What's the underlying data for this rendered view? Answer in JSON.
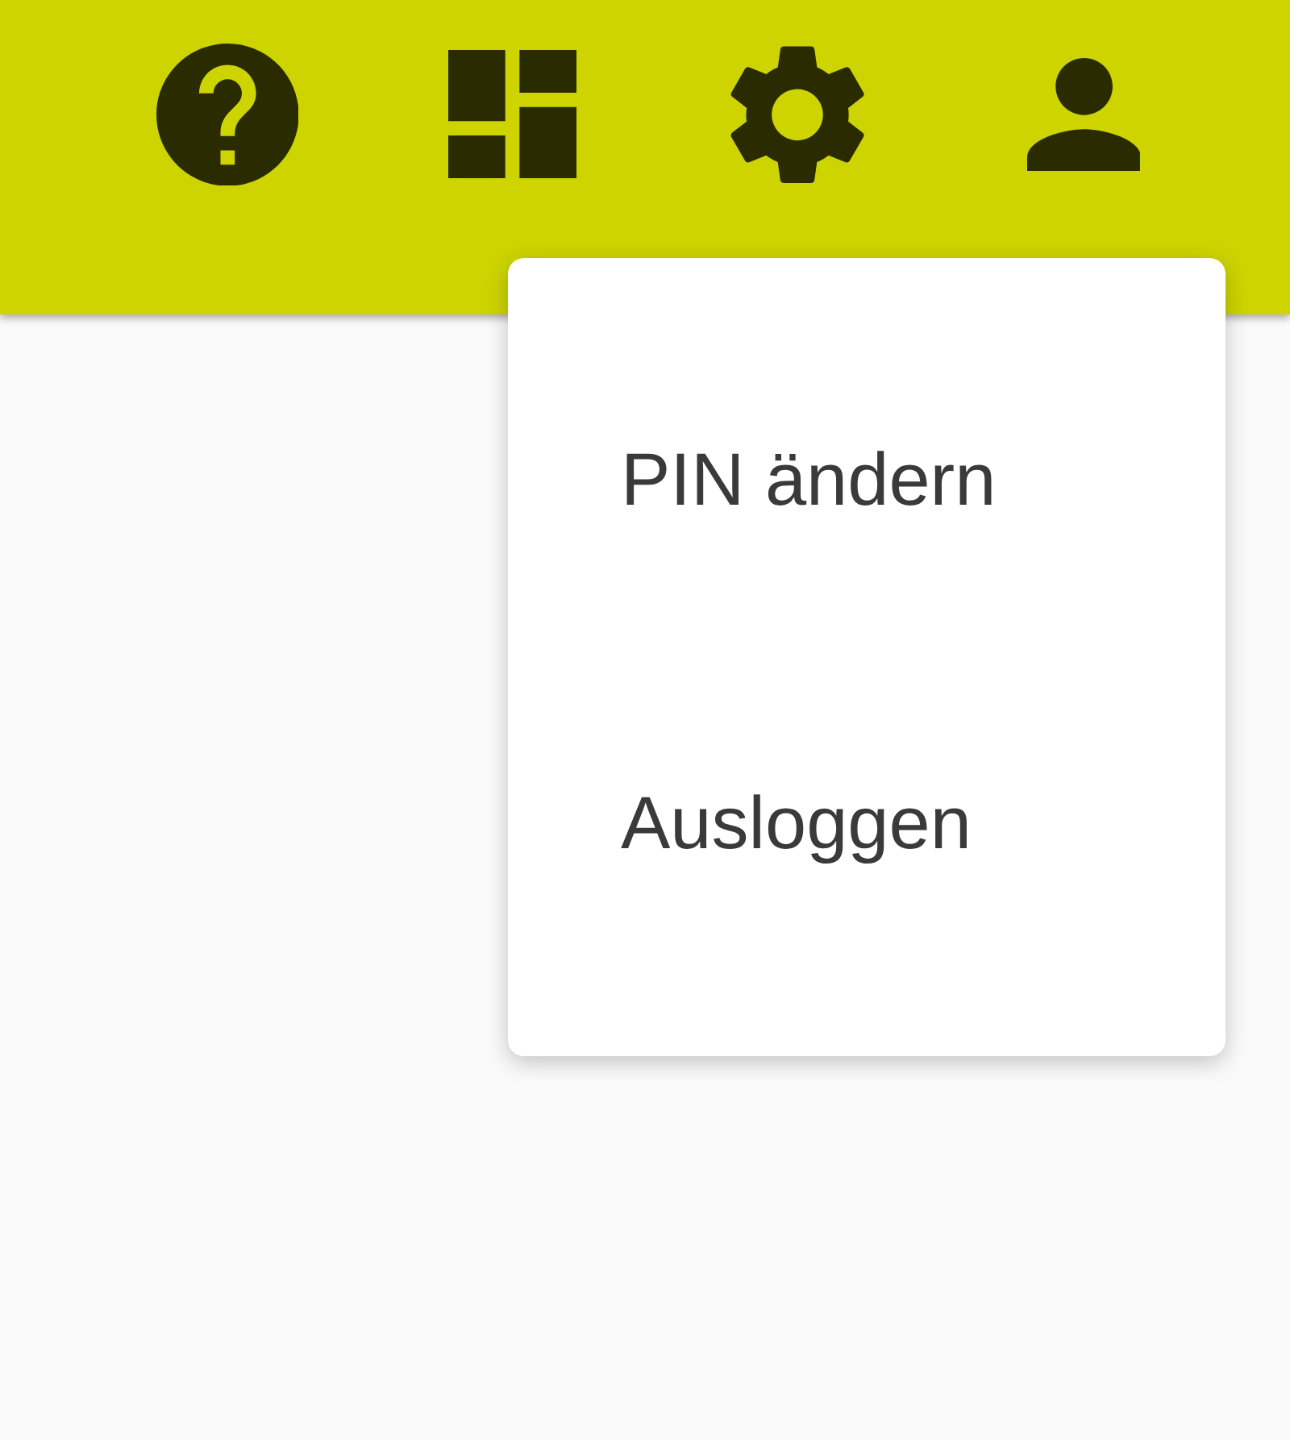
{
  "toolbar": {
    "icons": [
      {
        "kind": "help"
      },
      {
        "kind": "dashboard"
      },
      {
        "kind": "settings"
      },
      {
        "kind": "account"
      }
    ]
  },
  "menu": {
    "items": [
      {
        "label": "PIN ändern"
      },
      {
        "label": "Ausloggen"
      }
    ]
  }
}
